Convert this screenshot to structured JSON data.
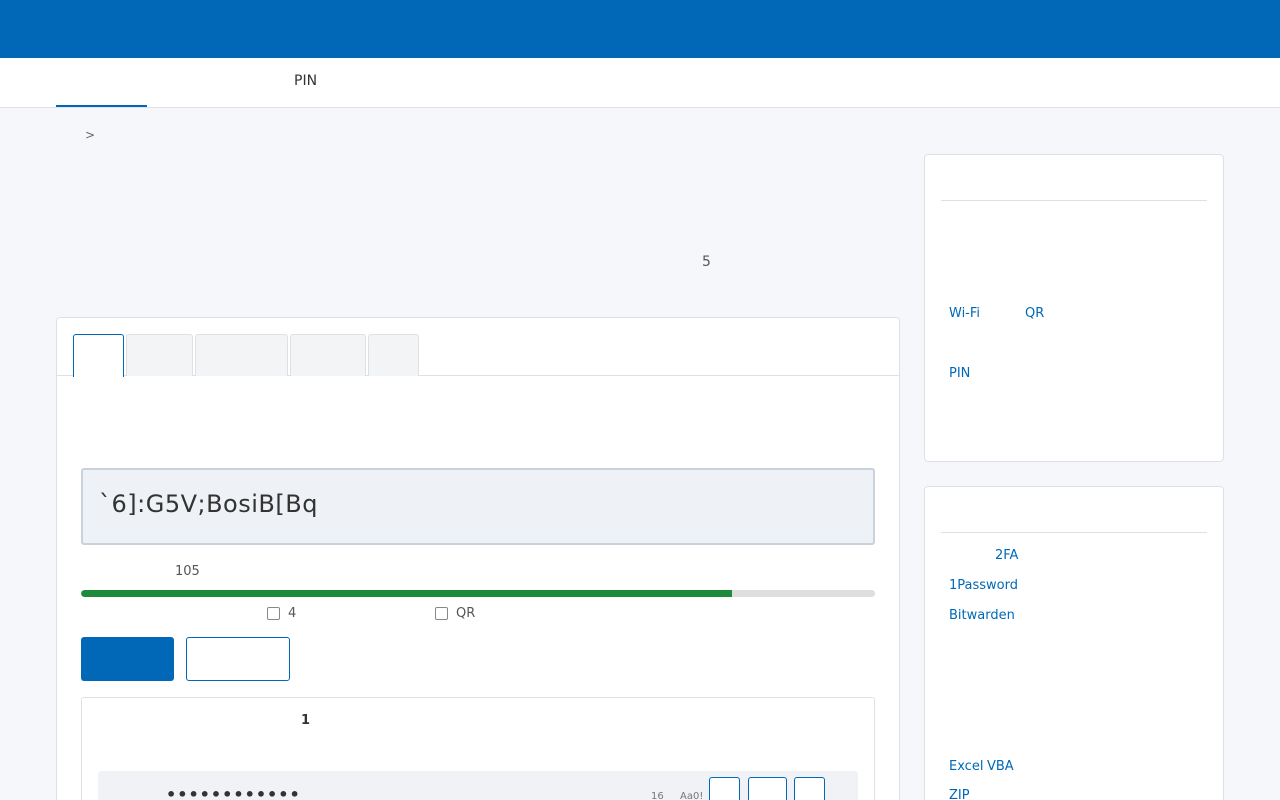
{
  "nav": {
    "pin_tab": "PIN"
  },
  "breadcrumb": {
    "separator": ">"
  },
  "hero": {
    "number": "5"
  },
  "generator": {
    "password": "`6]:G5V;BosiB[Bq",
    "strength_value": "105",
    "strength_fraction": 0.82,
    "options": [
      {
        "label": "4",
        "checked": false
      },
      {
        "label": "QR",
        "checked": false
      }
    ]
  },
  "history": {
    "title": "1",
    "masked_password": "••••••••••••",
    "length": "16",
    "char_types": "Aa0!"
  },
  "sidebar": {
    "card1_links": [
      {
        "a": "Wi-Fi",
        "b": "QR"
      },
      {
        "a": "PIN",
        "b": ""
      }
    ],
    "card2_links": [
      {
        "text": "2FA"
      },
      {
        "text": "1Password"
      },
      {
        "text": "Bitwarden"
      },
      {
        "a": "Excel",
        "b": "VBA"
      },
      {
        "text": "ZIP"
      }
    ]
  },
  "colors": {
    "brand": "#0068b7",
    "strength": "#1e8a3c"
  }
}
